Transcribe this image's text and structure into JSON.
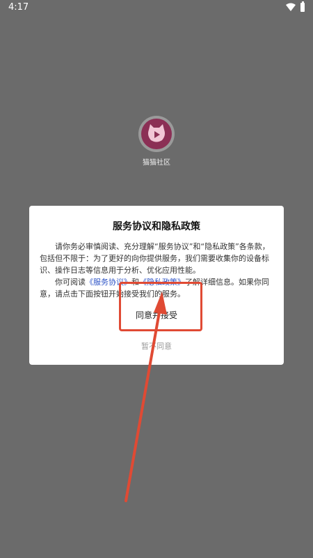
{
  "status_bar": {
    "time": "4:17"
  },
  "app": {
    "name": "猫猫社区"
  },
  "dialog": {
    "title": "服务协议和隐私政策",
    "paragraph1": "请你务必审慎阅读、充分理解“服务协议”和“隐私政策”各条款，包括但不限于：为了更好的向你提供服务，我们需要收集你的设备标识、操作日志等信息用于分析、优化应用性能。",
    "p2_prefix": "你可阅读",
    "link_service": "《服务协议》",
    "p2_and": "和",
    "link_privacy": "《隐私政策》",
    "p2_suffix": "了解详细信息。如果你同意，请点击下面按钮开始接受我们的服务。",
    "agree_label": "同意并接受",
    "disagree_label": "暂不同意"
  },
  "colors": {
    "overlay": "#6b6b6b",
    "link": "#2e54c7",
    "annotation": "#e04a34"
  }
}
